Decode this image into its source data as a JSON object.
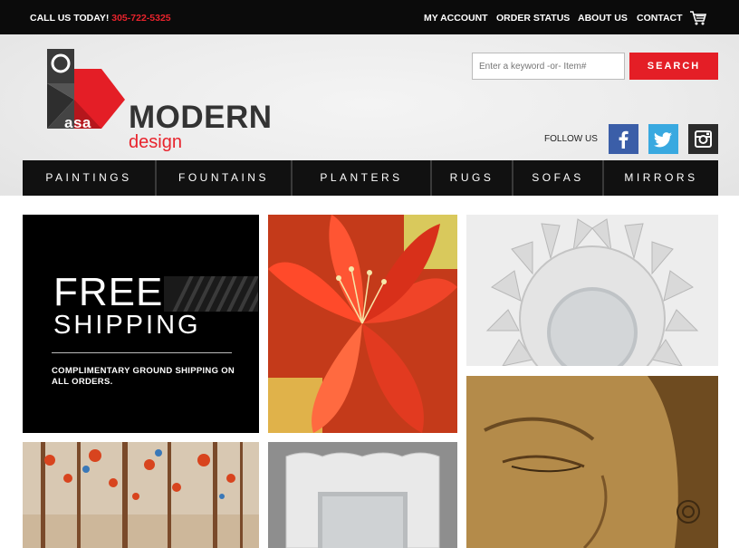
{
  "topbar": {
    "call_label": "CALL US TODAY!",
    "phone": "305-722-5325",
    "links": [
      "MY ACCOUNT",
      "ORDER STATUS",
      "ABOUT US",
      "CONTACT"
    ],
    "cart_icon": "shopping-cart-icon"
  },
  "brand": {
    "logo_small": "asa",
    "logo_main": "MODERN",
    "logo_sub": "design",
    "accent_color": "#e41e26"
  },
  "search": {
    "placeholder": "Enter a keyword -or- Item#",
    "button_label": "SEARCH"
  },
  "social": {
    "follow_label": "FOLLOW US",
    "icons": [
      "facebook-icon",
      "twitter-icon",
      "instagram-icon"
    ]
  },
  "categories": [
    "PAINTINGS",
    "FOUNTAINS",
    "PLANTERS",
    "RUGS",
    "SOFAS",
    "MIRRORS"
  ],
  "promo": {
    "headline": "FREE",
    "subheadline": "SHIPPING",
    "details": "COMPLIMENTARY GROUND SHIPPING ON ALL ORDERS."
  }
}
